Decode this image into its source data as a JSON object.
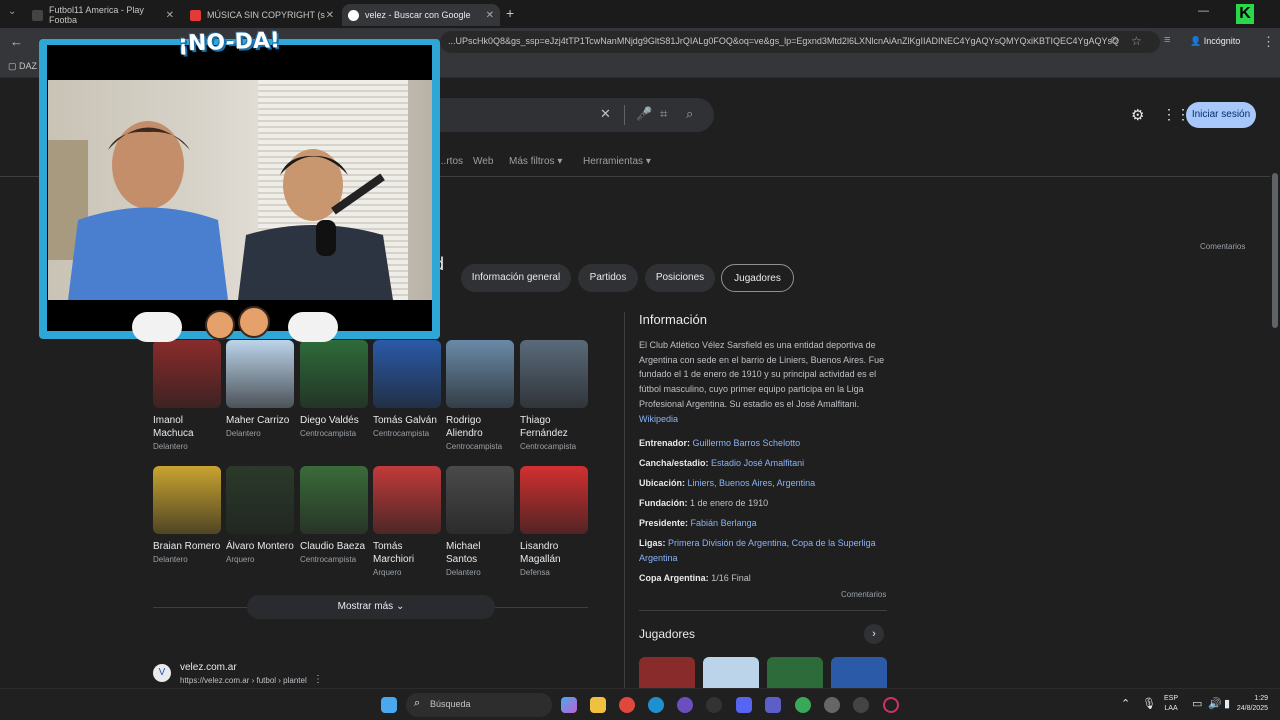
{
  "tabs": [
    {
      "title": "Futbol11 America - Play Footba",
      "icon": "futbol11-favicon"
    },
    {
      "title": "MÚSICA SIN COPYRIGHT (s",
      "icon": "youtube-icon"
    },
    {
      "title": "velez - Buscar con Google",
      "icon": "google-icon"
    }
  ],
  "omnibar": {
    "url": "...UPscHk0Q8&gs_ssp=eJzj4tTP1TcwNanMNjdg9GltS81JrQIALg0FOQ&oq=ve&gs_lp=Egxnd3Mtd2l6LXNlcnAiAnZlKgIIADINEC4YgAQYsQMYQxiKBTIQEC4YgAQYsQ",
    "mode_label": "Incógnito"
  },
  "bookmarks": {
    "first": "DAZ"
  },
  "search": {
    "nav": [
      "...rtos",
      "Web",
      "Más filtros",
      "Herramientas"
    ],
    "signin_label": "Iniciar sesión",
    "feedback_top": "Comentarios"
  },
  "chips": [
    "Información general",
    "Partidos",
    "Posiciones",
    "Jugadores"
  ],
  "players": [
    {
      "name": "Imanol Machuca",
      "pos": "Delantero",
      "color": "#8a2b2b"
    },
    {
      "name": "Maher Carrizo",
      "pos": "Delantero",
      "color": "#bcd4ea"
    },
    {
      "name": "Diego Valdés",
      "pos": "Centrocampista",
      "color": "#2e6b3a"
    },
    {
      "name": "Tomás Galván",
      "pos": "Centrocampista",
      "color": "#2a5aa8"
    },
    {
      "name": "Rodrigo Aliendro",
      "pos": "Centrocampista",
      "color": "#6a8aa8"
    },
    {
      "name": "Thiago Fernández",
      "pos": "Centrocampista",
      "color": "#5a6a7a"
    },
    {
      "name": "Braian Romero",
      "pos": "Delantero",
      "color": "#c9a430"
    },
    {
      "name": "Álvaro Montero",
      "pos": "Arquero",
      "color": "#2a3a2a"
    },
    {
      "name": "Claudio Baeza",
      "pos": "Centrocampista",
      "color": "#3a6b3a"
    },
    {
      "name": "Tomás Marchiori",
      "pos": "Arquero",
      "color": "#c23a3a"
    },
    {
      "name": "Michael Santos",
      "pos": "Delantero",
      "color": "#4a4a4a"
    },
    {
      "name": "Lisandro Magallán",
      "pos": "Defensa",
      "color": "#d23030"
    }
  ],
  "more_label": "Mostrar más",
  "result": {
    "site": "velez.com.ar",
    "breadcrumb": "https://velez.com.ar › futbol › plantel"
  },
  "info": {
    "title": "Información",
    "desc": "El Club Atlético Vélez Sarsfield es una entidad deportiva de Argentina con sede en el barrio de Liniers, Buenos Aires. Fue fundado el 1 de enero de 1910 y su principal actividad es el fútbol masculino, cuyo primer equipo participa en la Liga Profesional Argentina. Su estadio es el José Amalfitani.",
    "wiki": "Wikipedia",
    "facts": [
      {
        "k": "Entrenador:",
        "v": "Guillermo Barros Schelotto",
        "link": true
      },
      {
        "k": "Cancha/estadio:",
        "v": "Estadio José Amalfitani",
        "link": true
      },
      {
        "k": "Ubicación:",
        "v": "Liniers, Buenos Aires, Argentina",
        "link": true
      },
      {
        "k": "Fundación:",
        "v": "1 de enero de 1910",
        "link": false
      },
      {
        "k": "Presidente:",
        "v": "Fabián Berlanga",
        "link": true
      },
      {
        "k": "Ligas:",
        "v": "Primera División de Argentina, Copa de la Superliga Argentina",
        "link": true
      },
      {
        "k": "Copa Argentina:",
        "v": "1/16 Final",
        "link": false
      }
    ],
    "feedback": "Comentarios",
    "players_title": "Jugadores"
  },
  "overlay": {
    "title": "¡NO-DA!"
  },
  "taskbar": {
    "search_label": "Búsqueda",
    "lang1": "ESP",
    "lang2": "LAA",
    "time": "1:29",
    "date": "24/8/2025"
  }
}
